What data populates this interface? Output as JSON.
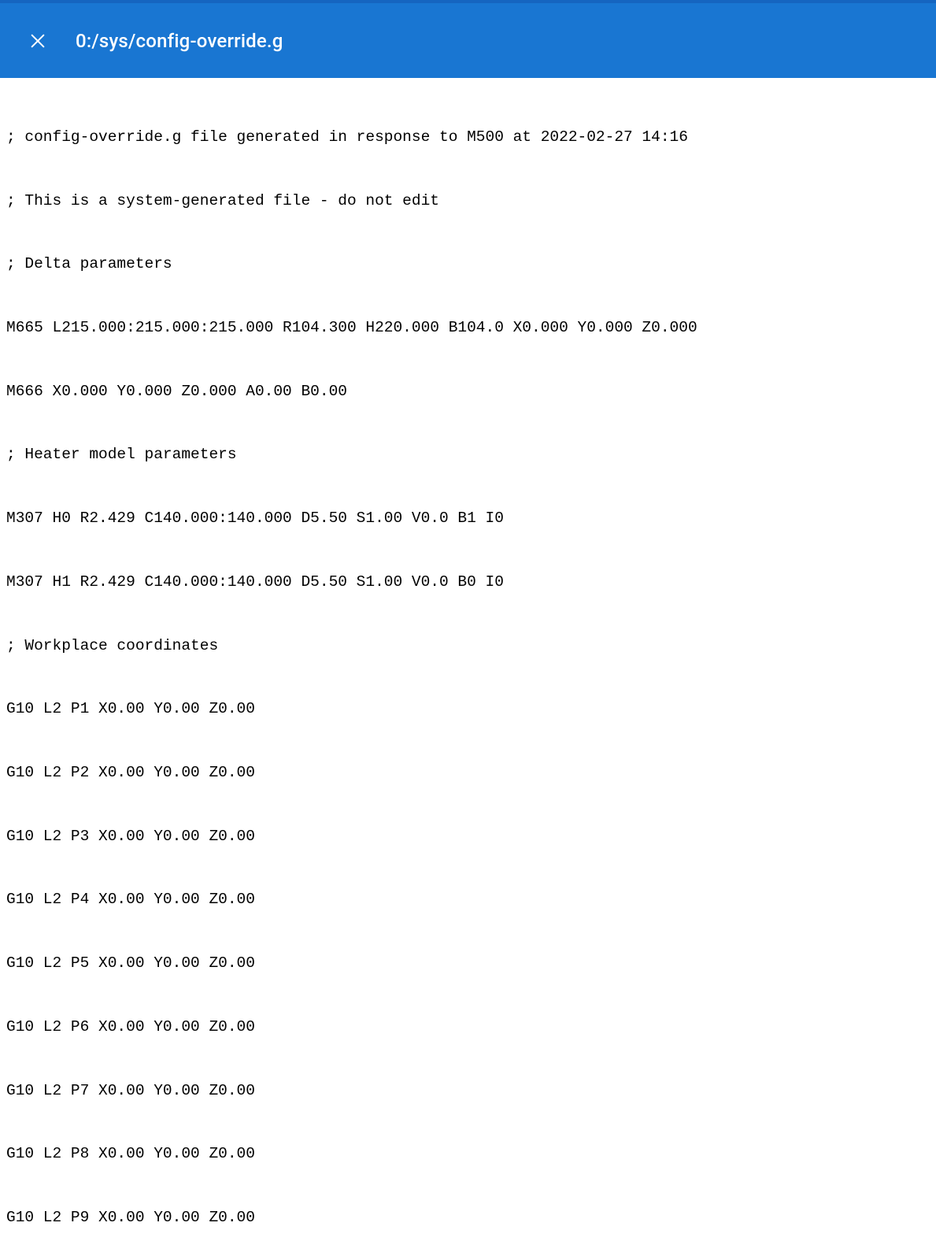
{
  "header": {
    "title": "0:/sys/config-override.g"
  },
  "file": {
    "lines": [
      "; config-override.g file generated in response to M500 at 2022-02-27 14:16",
      "; This is a system-generated file - do not edit",
      "; Delta parameters",
      "M665 L215.000:215.000:215.000 R104.300 H220.000 B104.0 X0.000 Y0.000 Z0.000",
      "M666 X0.000 Y0.000 Z0.000 A0.00 B0.00",
      "; Heater model parameters",
      "M307 H0 R2.429 C140.000:140.000 D5.50 S1.00 V0.0 B1 I0",
      "M307 H1 R2.429 C140.000:140.000 D5.50 S1.00 V0.0 B0 I0",
      "; Workplace coordinates",
      "G10 L2 P1 X0.00 Y0.00 Z0.00",
      "G10 L2 P2 X0.00 Y0.00 Z0.00",
      "G10 L2 P3 X0.00 Y0.00 Z0.00",
      "G10 L2 P4 X0.00 Y0.00 Z0.00",
      "G10 L2 P5 X0.00 Y0.00 Z0.00",
      "G10 L2 P6 X0.00 Y0.00 Z0.00",
      "G10 L2 P7 X0.00 Y0.00 Z0.00",
      "G10 L2 P8 X0.00 Y0.00 Z0.00",
      "G10 L2 P9 X0.00 Y0.00 Z0.00"
    ]
  }
}
